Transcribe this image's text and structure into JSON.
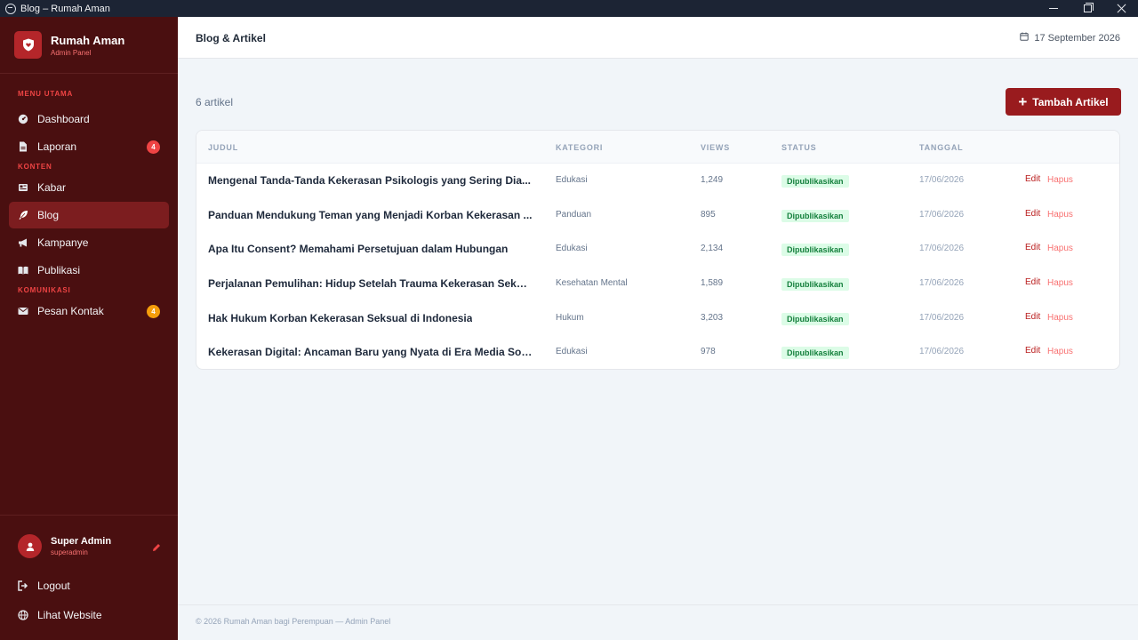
{
  "window": {
    "title": "Blog – Rumah Aman"
  },
  "brand": {
    "name": "Rumah Aman",
    "subtitle": "Admin Panel"
  },
  "sidebar": {
    "sections": [
      {
        "label": "MENU UTAMA"
      },
      {
        "label": "KONTEN"
      },
      {
        "label": "KOMUNIKASI"
      }
    ],
    "items": [
      {
        "label": "Dashboard",
        "icon": "gauge-icon"
      },
      {
        "label": "Laporan",
        "icon": "file-icon",
        "badge": "4",
        "badge_color": "#ef4444"
      },
      {
        "label": "Kabar",
        "icon": "newspaper-icon"
      },
      {
        "label": "Blog",
        "icon": "feather-icon",
        "active": true
      },
      {
        "label": "Kampanye",
        "icon": "megaphone-icon"
      },
      {
        "label": "Publikasi",
        "icon": "book-icon"
      },
      {
        "label": "Pesan Kontak",
        "icon": "envelope-icon",
        "badge": "4",
        "badge_color": "#f59e0b"
      }
    ]
  },
  "user": {
    "name": "Super Admin",
    "role": "superadmin"
  },
  "bottom_nav": {
    "logout": "Logout",
    "website": "Lihat Website"
  },
  "header": {
    "title": "Blog & Artikel",
    "date": "17 September 2026"
  },
  "main": {
    "count": "6 artikel",
    "add_button": "Tambah Artikel"
  },
  "table": {
    "headers": {
      "title": "JUDUL",
      "category": "KATEGORI",
      "views": "VIEWS",
      "status": "STATUS",
      "date": "TANGGAL"
    },
    "rows": [
      {
        "title": "Mengenal Tanda-Tanda Kekerasan Psikologis yang Sering Dia...",
        "category": "Edukasi",
        "views": "1,249",
        "status": "Dipublikasikan",
        "date": "17/06/2026",
        "edit": "Edit",
        "delete": "Hapus"
      },
      {
        "title": "Panduan Mendukung Teman yang Menjadi Korban Kekerasan ...",
        "category": "Panduan",
        "views": "895",
        "status": "Dipublikasikan",
        "date": "17/06/2026",
        "edit": "Edit",
        "delete": "Hapus"
      },
      {
        "title": "Apa Itu Consent? Memahami Persetujuan dalam Hubungan",
        "category": "Edukasi",
        "views": "2,134",
        "status": "Dipublikasikan",
        "date": "17/06/2026",
        "edit": "Edit",
        "delete": "Hapus"
      },
      {
        "title": "Perjalanan Pemulihan: Hidup Setelah Trauma Kekerasan Seksual",
        "category": "Kesehatan Mental",
        "views": "1,589",
        "status": "Dipublikasikan",
        "date": "17/06/2026",
        "edit": "Edit",
        "delete": "Hapus"
      },
      {
        "title": "Hak Hukum Korban Kekerasan Seksual di Indonesia",
        "category": "Hukum",
        "views": "3,203",
        "status": "Dipublikasikan",
        "date": "17/06/2026",
        "edit": "Edit",
        "delete": "Hapus"
      },
      {
        "title": "Kekerasan Digital: Ancaman Baru yang Nyata di Era Media Sosial",
        "category": "Edukasi",
        "views": "978",
        "status": "Dipublikasikan",
        "date": "17/06/2026",
        "edit": "Edit",
        "delete": "Hapus"
      }
    ]
  },
  "footer": {
    "text": "© 2026 Rumah Aman bagi Perempuan — Admin Panel"
  }
}
